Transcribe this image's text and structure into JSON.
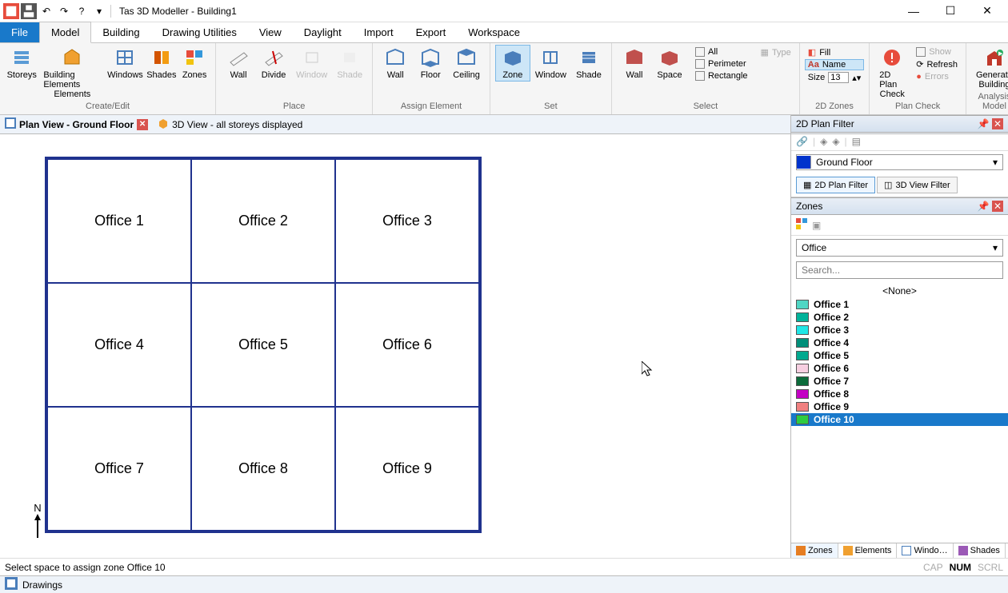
{
  "app_title": "Tas 3D Modeller - Building1",
  "qat": [
    "app-icon",
    "save-icon",
    "undo-icon",
    "redo-icon",
    "help-icon",
    "dropdown-icon",
    "sep"
  ],
  "ribbon_tabs": [
    "File",
    "Model",
    "Building",
    "Drawing Utilities",
    "View",
    "Daylight",
    "Import",
    "Export",
    "Workspace"
  ],
  "ribbon_active": "Model",
  "ribbon_groups": {
    "create_edit": {
      "label": "Create/Edit",
      "buttons": [
        "Storeys",
        "Building Elements",
        "Windows",
        "Shades",
        "Zones"
      ]
    },
    "place": {
      "label": "Place",
      "buttons": [
        "Wall",
        "Divide",
        "Window",
        "Shade"
      ],
      "disabled": [
        "Window",
        "Shade"
      ]
    },
    "assign": {
      "label": "Assign Element",
      "buttons": [
        "Wall",
        "Floor",
        "Ceiling"
      ]
    },
    "set": {
      "label": "Set",
      "buttons": [
        "Zone",
        "Window",
        "Shade"
      ],
      "selected": "Zone"
    },
    "select_group": {
      "label": "Select",
      "buttons": [
        "Wall",
        "Space"
      ],
      "checks": [
        {
          "k": "All",
          "on": false
        },
        {
          "k": "Perimeter",
          "on": false
        },
        {
          "k": "Rectangle",
          "on": false
        }
      ],
      "type_label": "Type"
    },
    "zones2d": {
      "label": "2D Zones",
      "fill": "Fill",
      "name": "Name",
      "size_label": "Size",
      "size_value": "13"
    },
    "plancheck": {
      "label": "Plan Check",
      "button": "2D Plan Check",
      "show": "Show",
      "refresh": "Refresh",
      "errors": "Errors"
    },
    "analysis": {
      "label": "Analysis Model",
      "button": "Generate Building"
    }
  },
  "view_tabs": [
    {
      "label": "Plan View - Ground Floor",
      "active": true
    },
    {
      "label": "3D View - all storeys displayed",
      "active": false
    }
  ],
  "plan_cells": [
    "Office 1",
    "Office 2",
    "Office 3",
    "Office 4",
    "Office 5",
    "Office 6",
    "Office 7",
    "Office 8",
    "Office 9"
  ],
  "north_label": "N",
  "side": {
    "plan_filter_hdr": "2D Plan Filter",
    "floor": "Ground Floor",
    "filter_tabs": [
      "2D Plan Filter",
      "3D View Filter"
    ],
    "zones_hdr": "Zones",
    "zone_type": "Office",
    "search_placeholder": "Search...",
    "none_label": "<None>",
    "zone_items": [
      {
        "label": "Office 1",
        "color": "#4fd6c4"
      },
      {
        "label": "Office 2",
        "color": "#00b39a"
      },
      {
        "label": "Office 3",
        "color": "#20e6e6"
      },
      {
        "label": "Office 4",
        "color": "#008f7a"
      },
      {
        "label": "Office 5",
        "color": "#00a98f"
      },
      {
        "label": "Office 6",
        "color": "#f7cfe1"
      },
      {
        "label": "Office 7",
        "color": "#0b6b3a"
      },
      {
        "label": "Office 8",
        "color": "#c400c4"
      },
      {
        "label": "Office 9",
        "color": "#f08080"
      },
      {
        "label": "Office 10",
        "color": "#2ecc40",
        "selected": true
      }
    ],
    "bottom_tabs": [
      "Zones",
      "Elements",
      "Windo…",
      "Shades"
    ]
  },
  "status": "Select space to assign zone Office 10",
  "status_right": [
    "CAP",
    "NUM",
    "SCRL"
  ],
  "footer": "Drawings"
}
